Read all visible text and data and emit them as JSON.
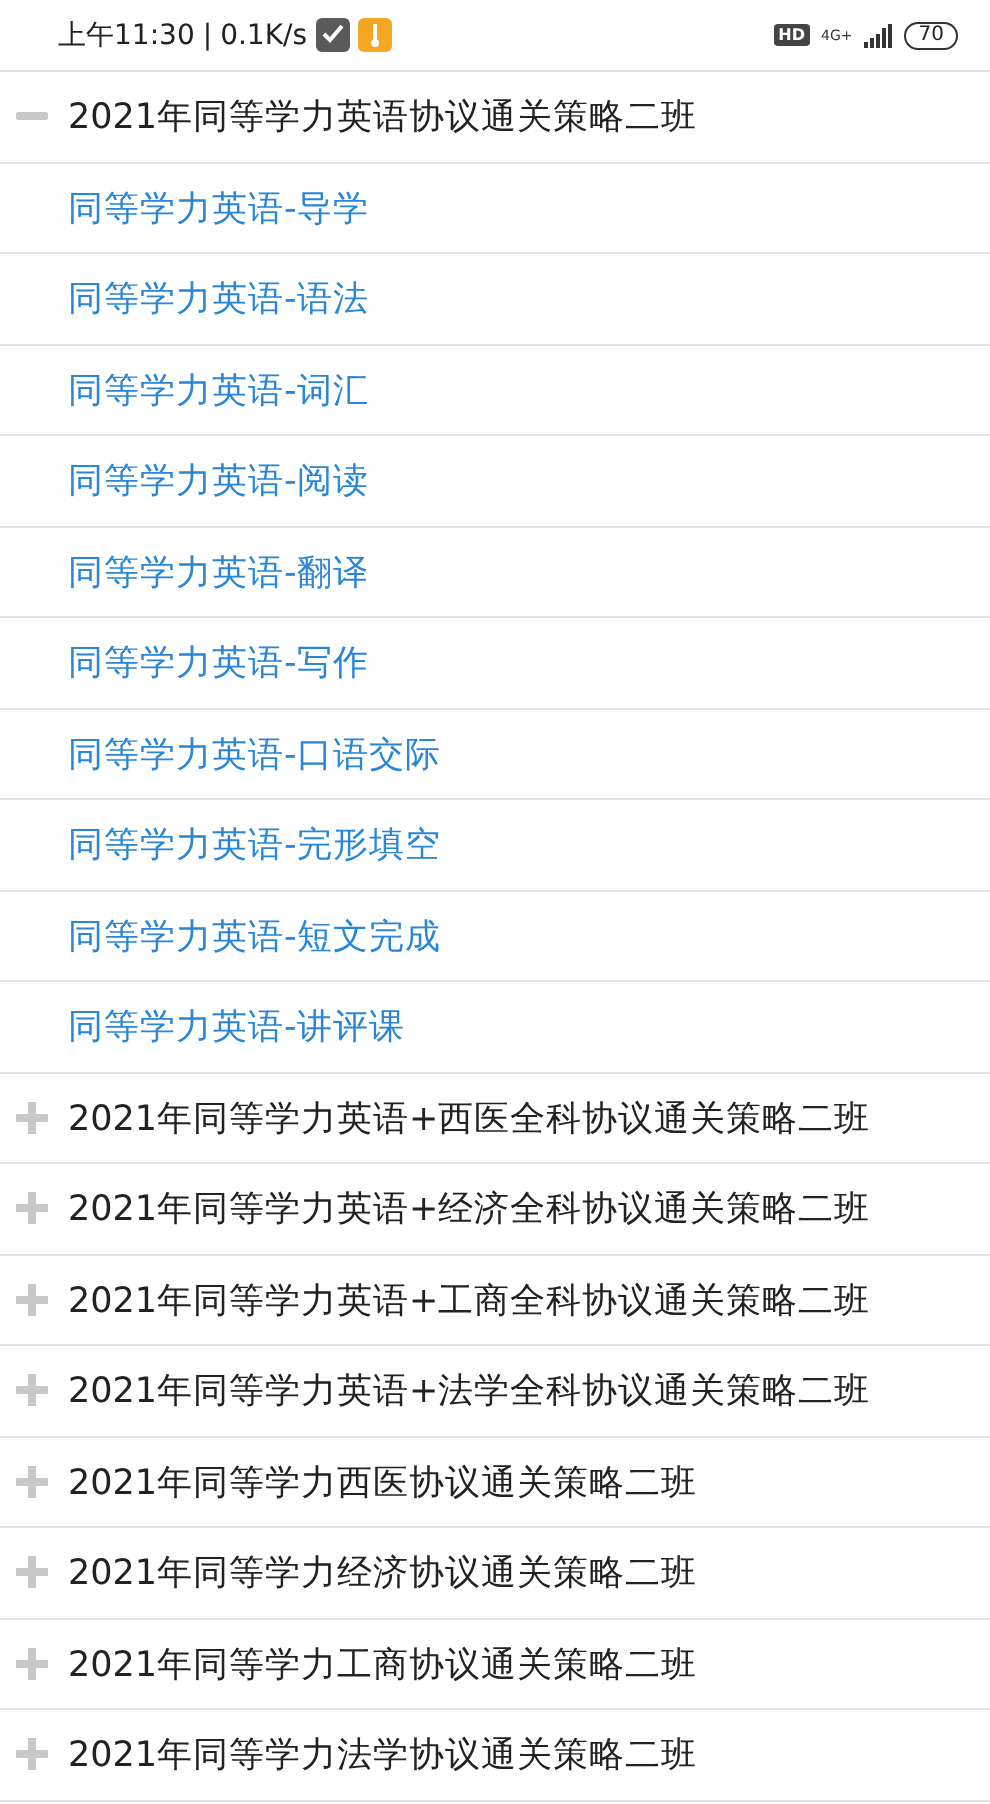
{
  "status_bar": {
    "time": "上午11:30",
    "separator": "|",
    "speed": "0.1K/s",
    "hd": "HD",
    "network": "4G+",
    "battery": "70"
  },
  "tree": [
    {
      "label": "2021年同等学力英语协议通关策略二班",
      "expanded": true,
      "children": [
        {
          "label": "同等学力英语-导学"
        },
        {
          "label": "同等学力英语-语法"
        },
        {
          "label": "同等学力英语-词汇"
        },
        {
          "label": "同等学力英语-阅读"
        },
        {
          "label": "同等学力英语-翻译"
        },
        {
          "label": "同等学力英语-写作"
        },
        {
          "label": "同等学力英语-口语交际"
        },
        {
          "label": "同等学力英语-完形填空"
        },
        {
          "label": "同等学力英语-短文完成"
        },
        {
          "label": "同等学力英语-讲评课"
        }
      ]
    },
    {
      "label": "2021年同等学力英语+西医全科协议通关策略二班",
      "expanded": false
    },
    {
      "label": "2021年同等学力英语+经济全科协议通关策略二班",
      "expanded": false
    },
    {
      "label": "2021年同等学力英语+工商全科协议通关策略二班",
      "expanded": false
    },
    {
      "label": "2021年同等学力英语+法学全科协议通关策略二班",
      "expanded": false
    },
    {
      "label": "2021年同等学力西医协议通关策略二班",
      "expanded": false
    },
    {
      "label": "2021年同等学力经济协议通关策略二班",
      "expanded": false
    },
    {
      "label": "2021年同等学力工商协议通关策略二班",
      "expanded": false
    },
    {
      "label": "2021年同等学力法学协议通关策略二班",
      "expanded": false
    }
  ]
}
